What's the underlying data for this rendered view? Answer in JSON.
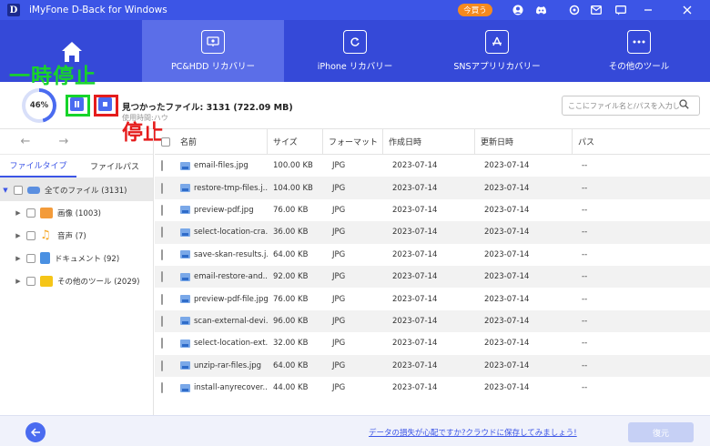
{
  "titlebar": {
    "logo": "D",
    "title": "iMyFone D-Back for Windows",
    "buy_label": "今買う"
  },
  "nav": {
    "tabs": [
      {
        "label": "",
        "icon": "home-icon"
      },
      {
        "label": "PC&HDD リカバリー",
        "icon": "monitor-icon"
      },
      {
        "label": "iPhone リカバリー",
        "icon": "refresh-icon"
      },
      {
        "label": "SNSアプリリカバリー",
        "icon": "app-store-icon"
      },
      {
        "label": "その他のツール",
        "icon": "more-icon"
      }
    ]
  },
  "scan": {
    "progress_percent": 46,
    "progress_label": "46%",
    "found_text": "見つかったファイル: 3131 (722.09 MB)",
    "elapsed_text": "使用時間:ハウ",
    "search_placeholder": "ここにファイル名と/パスを入力してくだ..."
  },
  "annotations": {
    "pause": "一時停止",
    "stop": "停止"
  },
  "sidebar": {
    "tabs": [
      "ファイルタイプ",
      "ファイルパス"
    ],
    "tree": [
      {
        "label": "全てのファイル (3131)",
        "color": "#5b8fe0"
      },
      {
        "label": "画像 (1003)",
        "color": "#f39b3a"
      },
      {
        "label": "音声 (7)",
        "color": "#f5a623"
      },
      {
        "label": "ドキュメント (92)",
        "color": "#4a90e2"
      },
      {
        "label": "その他のツール (2029)",
        "color": "#f5c518"
      }
    ]
  },
  "table": {
    "headers": [
      "名前",
      "サイズ",
      "フォーマット",
      "作成日時",
      "更新日時",
      "パス"
    ],
    "rows": [
      [
        "email-files.jpg",
        "100.00 KB",
        "JPG",
        "2023-07-14",
        "2023-07-14",
        "--"
      ],
      [
        "restore-tmp-files.j...",
        "104.00 KB",
        "JPG",
        "2023-07-14",
        "2023-07-14",
        "--"
      ],
      [
        "preview-pdf.jpg",
        "76.00 KB",
        "JPG",
        "2023-07-14",
        "2023-07-14",
        "--"
      ],
      [
        "select-location-cra...",
        "36.00 KB",
        "JPG",
        "2023-07-14",
        "2023-07-14",
        "--"
      ],
      [
        "save-skan-results.j...",
        "64.00 KB",
        "JPG",
        "2023-07-14",
        "2023-07-14",
        "--"
      ],
      [
        "email-restore-and...",
        "92.00 KB",
        "JPG",
        "2023-07-14",
        "2023-07-14",
        "--"
      ],
      [
        "preview-pdf-file.jpg",
        "76.00 KB",
        "JPG",
        "2023-07-14",
        "2023-07-14",
        "--"
      ],
      [
        "scan-external-devi...",
        "96.00 KB",
        "JPG",
        "2023-07-14",
        "2023-07-14",
        "--"
      ],
      [
        "select-location-ext...",
        "32.00 KB",
        "JPG",
        "2023-07-14",
        "2023-07-14",
        "--"
      ],
      [
        "unzip-rar-files.jpg",
        "64.00 KB",
        "JPG",
        "2023-07-14",
        "2023-07-14",
        "--"
      ],
      [
        "install-anyrecover....",
        "44.00 KB",
        "JPG",
        "2023-07-14",
        "2023-07-14",
        "--"
      ]
    ]
  },
  "footer": {
    "cloud_link": "データの損失が心配ですか?クラウドに保存してみましょう!",
    "recover_label": "復元"
  }
}
